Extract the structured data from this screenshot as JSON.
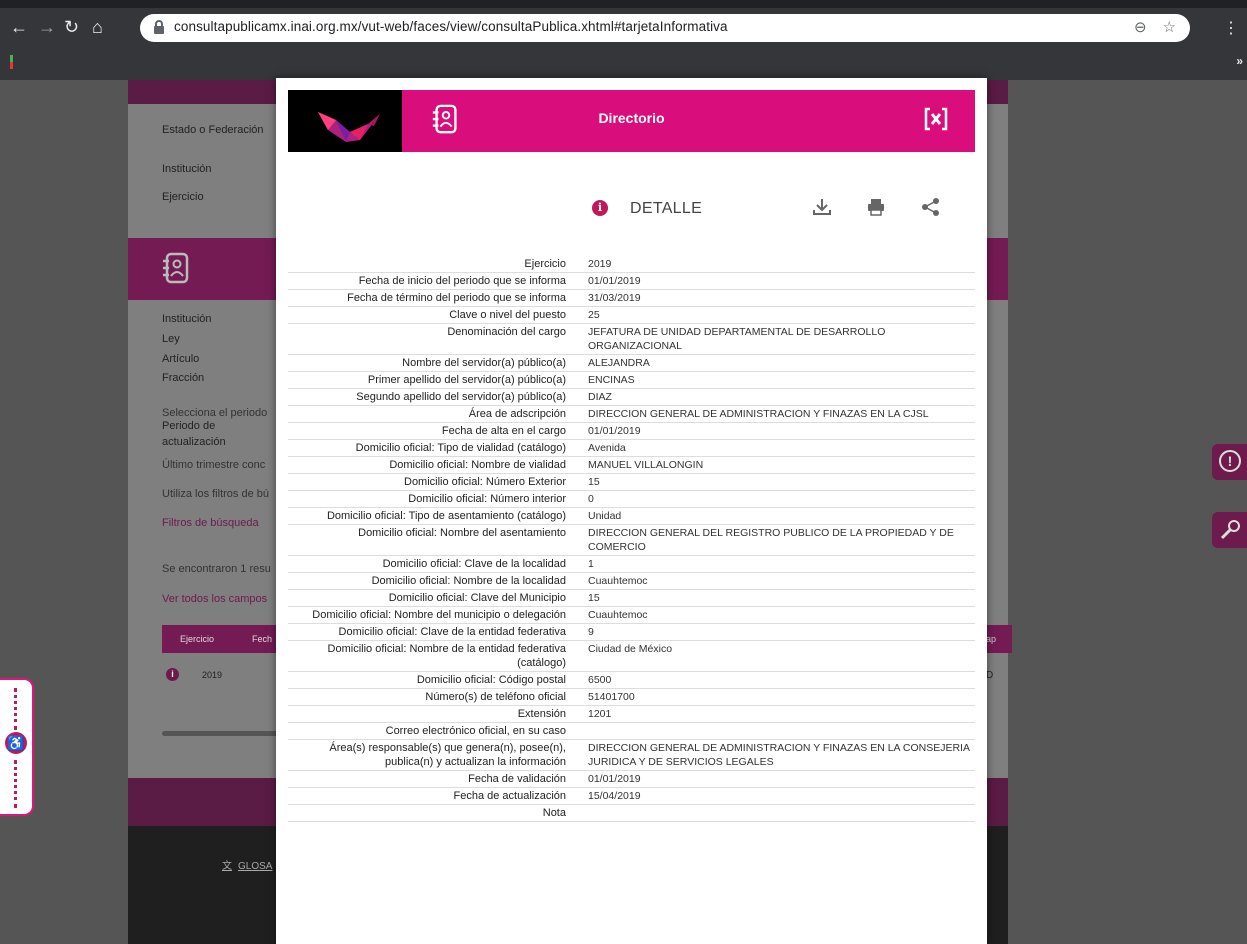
{
  "browser": {
    "url": "consultapublicamx.inai.org.mx/vut-web/faces/view/consultaPublica.xhtml#tarjetaInformativa"
  },
  "background": {
    "labels_top": [
      "Estado o Federación",
      "Institución",
      "Ejercicio"
    ],
    "labels_mid": [
      "Institución",
      "Ley",
      "Artículo",
      "Fracción"
    ],
    "periodo": [
      "Selecciona el periodo",
      "Periodo de",
      "actualización",
      "Último trimestre conc"
    ],
    "filtros_hint": "Utiliza los filtros de bú",
    "filtros_link": "Filtros de búsqueda",
    "resultados": "Se encontraron 1 resu",
    "ver_campos": "Ver todos los campos",
    "table_head": [
      "Ejercicio",
      "Fech"
    ],
    "row_year": "2019",
    "glosario": "GLOSA",
    "right_edge": [
      "ap",
      "D"
    ]
  },
  "modal": {
    "title": "Directorio",
    "detail_label": "DETALLE",
    "fields": [
      {
        "k": "Ejercicio",
        "v": "2019"
      },
      {
        "k": "Fecha de inicio del periodo que se informa",
        "v": "01/01/2019"
      },
      {
        "k": "Fecha de término del periodo que se informa",
        "v": "31/03/2019"
      },
      {
        "k": "Clave o nivel del puesto",
        "v": "25"
      },
      {
        "k": "Denominación del cargo",
        "v": "JEFATURA DE UNIDAD DEPARTAMENTAL DE DESARROLLO ORGANIZACIONAL"
      },
      {
        "k": "Nombre del servidor(a) público(a)",
        "v": "ALEJANDRA"
      },
      {
        "k": "Primer apellido del servidor(a) público(a)",
        "v": "ENCINAS"
      },
      {
        "k": "Segundo apellido del servidor(a) público(a)",
        "v": "DIAZ"
      },
      {
        "k": "Área de adscripción",
        "v": "DIRECCION GENERAL DE ADMINISTRACION Y FINAZAS EN LA CJSL"
      },
      {
        "k": "Fecha de alta en el cargo",
        "v": "01/01/2019"
      },
      {
        "k": "Domicilio oficial: Tipo de vialidad (catálogo)",
        "v": "Avenida"
      },
      {
        "k": "Domicilio oficial: Nombre de vialidad",
        "v": "MANUEL VILLALONGIN"
      },
      {
        "k": "Domicilio oficial: Número Exterior",
        "v": "15"
      },
      {
        "k": "Domicilio oficial: Número interior",
        "v": "0"
      },
      {
        "k": "Domicilio oficial: Tipo de asentamiento (catálogo)",
        "v": "Unidad"
      },
      {
        "k": "Domicilio oficial: Nombre del asentamiento",
        "v": "DIRECCION GENERAL DEL REGISTRO PUBLICO DE LA PROPIEDAD Y DE COMERCIO"
      },
      {
        "k": "Domicilio oficial: Clave de la localidad",
        "v": "1"
      },
      {
        "k": "Domicilio oficial: Nombre de la localidad",
        "v": "Cuauhtemoc"
      },
      {
        "k": "Domicilio oficial: Clave del Municipio",
        "v": "15"
      },
      {
        "k": "Domicilio oficial: Nombre del municipio o delegación",
        "v": "Cuauhtemoc"
      },
      {
        "k": "Domicilio oficial: Clave de la entidad federativa",
        "v": "9"
      },
      {
        "k": "Domicilio oficial: Nombre de la entidad federativa (catálogo)",
        "v": "Ciudad de México"
      },
      {
        "k": "Domicilio oficial: Código postal",
        "v": "6500"
      },
      {
        "k": "Número(s) de teléfono oficial",
        "v": "51401700"
      },
      {
        "k": "Extensión",
        "v": "1201"
      },
      {
        "k": "Correo electrónico oficial, en su caso",
        "v": ""
      },
      {
        "k": "Área(s) responsable(s) que genera(n), posee(n), publica(n) y actualizan la información",
        "v": "DIRECCION GENERAL DE ADMINISTRACION Y FINAZAS EN LA CONSEJERIA JURIDICA Y DE SERVICIOS LEGALES"
      },
      {
        "k": "Fecha de validación",
        "v": "01/01/2019"
      },
      {
        "k": "Fecha de actualización",
        "v": "15/04/2019"
      },
      {
        "k": "Nota",
        "v": ""
      }
    ]
  },
  "colors": {
    "brand_pink": "#d90d7b",
    "brand_purple": "#6d1a4d"
  }
}
